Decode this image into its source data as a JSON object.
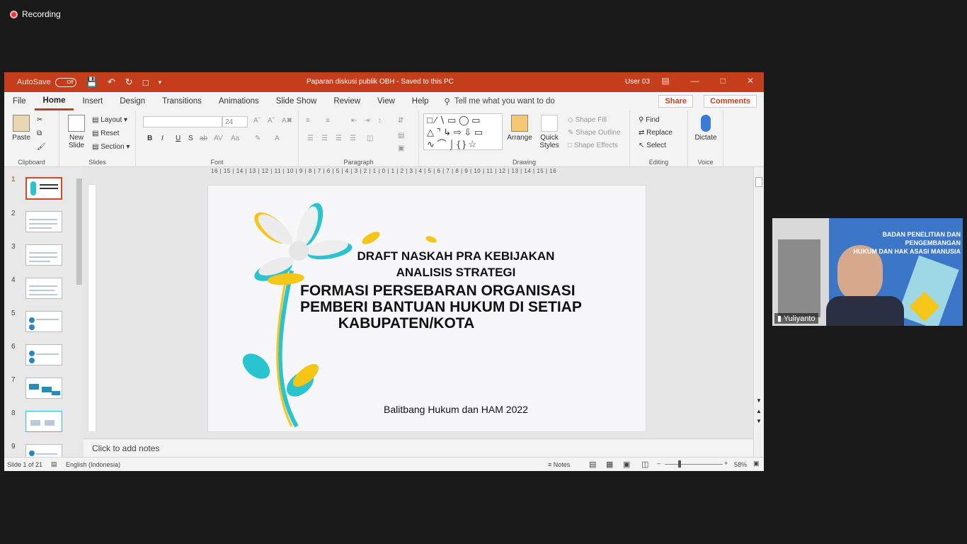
{
  "recording": {
    "label": "Recording"
  },
  "titlebar": {
    "autosave": "AutoSave",
    "autosave_state": "Off",
    "doc_title": "Paparan diskusi publik OBH  -  Saved to this PC",
    "user": "User 03"
  },
  "tabs": [
    "File",
    "Home",
    "Insert",
    "Design",
    "Transitions",
    "Animations",
    "Slide Show",
    "Review",
    "View",
    "Help"
  ],
  "tellme": "Tell me what you want to do",
  "share": "Share",
  "comments": "Comments",
  "ribbon": {
    "clipboard": {
      "label": "Clipboard",
      "paste": "Paste"
    },
    "slides": {
      "label": "Slides",
      "new_slide": "New\nSlide",
      "layout": "Layout",
      "reset": "Reset",
      "section": "Section"
    },
    "font": {
      "label": "Font",
      "size": "24",
      "bold": "B",
      "italic": "I",
      "underline": "U",
      "strike": "S",
      "shadow": "ab",
      "case": "Aa"
    },
    "paragraph": {
      "label": "Paragraph"
    },
    "drawing": {
      "label": "Drawing",
      "arrange": "Arrange",
      "quick_styles": "Quick\nStyles",
      "shape_fill": "Shape Fill",
      "shape_outline": "Shape Outline",
      "shape_effects": "Shape Effects"
    },
    "editing": {
      "label": "Editing",
      "find": "Find",
      "replace": "Replace",
      "select": "Select"
    },
    "voice": {
      "label": "Voice",
      "dictate": "Dictate"
    }
  },
  "ruler": "16 | 15 | 14 | 13 | 12 | 11 | 10 | 9 | 8 | 7 | 6 | 5 | 4 | 3 | 2 | 1 | 0 | 1 | 2 | 3 | 4 | 5 | 6 | 7 | 8 | 9 | 10 | 11 | 12 | 13 | 14 | 15 | 16",
  "thumbnails": [
    "1",
    "2",
    "3",
    "4",
    "5",
    "6",
    "7",
    "8",
    "9"
  ],
  "slide": {
    "line1": "DRAFT NASKAH PRA KEBIJAKAN",
    "line2": "ANALISIS STRATEGI",
    "line3": "FORMASI PERSEBARAN ORGANISASI",
    "line4": "PEMBERI BANTUAN HUKUM DI SETIAP",
    "line5": "KABUPATEN/KOTA",
    "footer": "Balitbang Hukum dan HAM 2022"
  },
  "notes_placeholder": "Click to add notes",
  "status": {
    "slide": "Slide 1 of 21",
    "language": "English (Indonesia)",
    "notes": "Notes",
    "zoom": "58%"
  },
  "video": {
    "name": "Yuliyanto",
    "header1": "BADAN PENELITIAN DAN PENGEMBANGAN",
    "header2": "HUKUM DAN HAK ASASI MANUSIA"
  },
  "colors": {
    "accent": "#c43e1c",
    "teal": "#29c4cf",
    "yellow": "#f5c518"
  }
}
